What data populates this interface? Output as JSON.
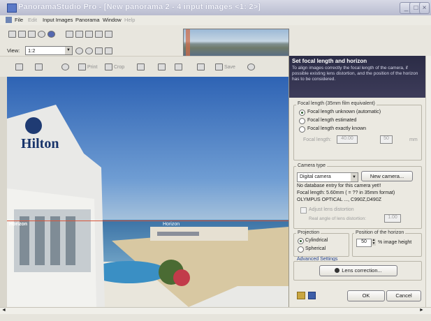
{
  "window": {
    "title": "PanoramaStudio Pro - [New panorama 2 - 4 input images <1: 2>]",
    "buttons": [
      "_",
      "□",
      "×"
    ]
  },
  "menu": {
    "items": [
      "File",
      "Edit",
      "Input Images",
      "Panorama",
      "Window",
      "Help"
    ]
  },
  "toolbar": {
    "view_label": "View:",
    "view_value": "1:2"
  },
  "toolbar2": {
    "crop_label": "Crop",
    "print_label": "Print",
    "save_label": "Save"
  },
  "image": {
    "hotel_sign": "Hilton",
    "horizon_left": "Horizon",
    "horizon_mid": "Horizon"
  },
  "panel": {
    "title": "Set focal length and horizon",
    "description": "To align images correctly the focal length of the camera, if possible existing lens distortion, and the position of the horizon has to be considered.",
    "focal_group": {
      "label": "Focal length (35mm film equivalent)",
      "options": [
        "Focal length unknown (automatic)",
        "Focal length estimated",
        "Focal length exactly known"
      ],
      "selected_index": 0,
      "range_label": "Focal length:",
      "range_from": "40.00",
      "range_to": "50",
      "unit": "mm"
    },
    "camera_group": {
      "label": "Camera type",
      "camera_value": "Digital camera",
      "new_camera_button": "New camera...",
      "db_line1": "No database entry for this camera yet!!",
      "db_line2": "Focal length: 5.60mm ( = ?? in 35mm format)",
      "db_line3": "OLYMPUS OPTICAL ..., C990Z,D490Z",
      "lens_checkbox": "Adjust lens distortion",
      "lens_angle_label": "Real angle of lens distortion:",
      "lens_angle_value": "1.00"
    },
    "projection_group": {
      "label": "Projection",
      "options": [
        "Cylindrical",
        "Spherical"
      ],
      "selected_index": 0
    },
    "horizon_group": {
      "label": "Position of the horizon",
      "value": "50",
      "unit": "% image height"
    },
    "advanced": {
      "label": "Advanced Settings",
      "lens_button": "Lens correction..."
    },
    "ok_button": "OK",
    "cancel_button": "Cancel"
  },
  "colors": {
    "panel_header": "#2b2c46",
    "horizon_line": "#d7553a",
    "sky": "#3a6fbf"
  }
}
